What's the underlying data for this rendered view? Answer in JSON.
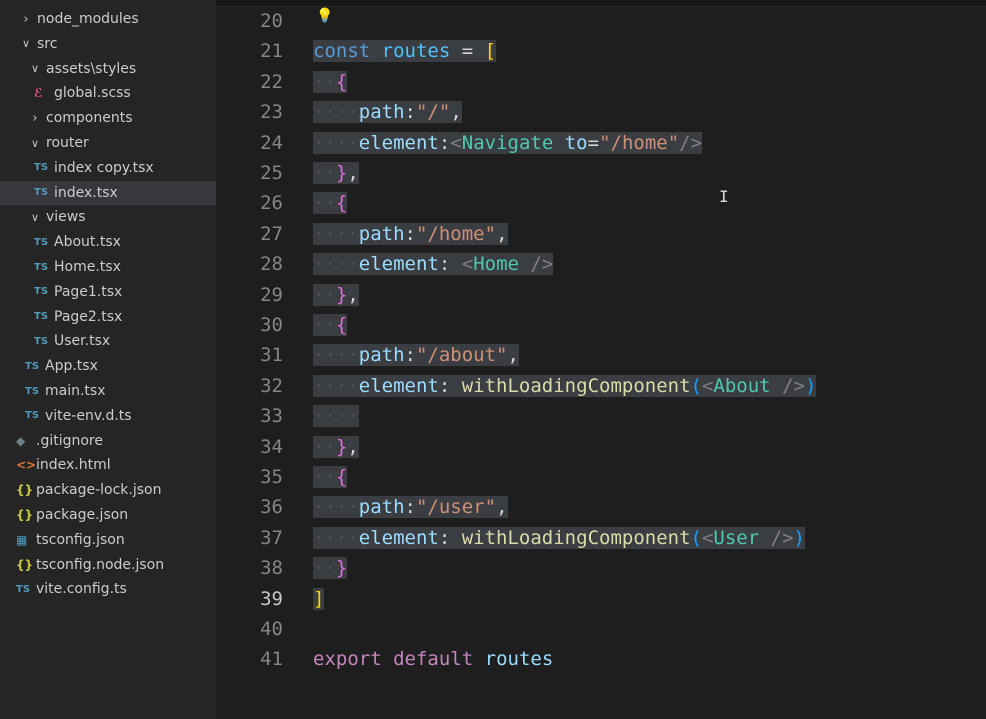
{
  "explorer": {
    "items": [
      {
        "label": "node_modules",
        "kind": "folder",
        "state": "collapsed",
        "depth": 0
      },
      {
        "label": "src",
        "kind": "folder",
        "state": "expanded",
        "depth": 0
      },
      {
        "label": "assets\\styles",
        "kind": "folder",
        "state": "expanded",
        "depth": 1
      },
      {
        "label": "global.scss",
        "kind": "scss",
        "icon": "scss-file-icon",
        "depth": 2
      },
      {
        "label": "components",
        "kind": "folder",
        "state": "collapsed",
        "depth": 1
      },
      {
        "label": "router",
        "kind": "folder",
        "state": "expanded",
        "depth": 1
      },
      {
        "label": "index copy.tsx",
        "kind": "ts",
        "icon": "ts-file-icon",
        "depth": 2
      },
      {
        "label": "index.tsx",
        "kind": "ts",
        "icon": "ts-file-icon",
        "depth": 2,
        "selected": true
      },
      {
        "label": "views",
        "kind": "folder",
        "state": "expanded",
        "depth": 1
      },
      {
        "label": "About.tsx",
        "kind": "ts",
        "icon": "ts-file-icon",
        "depth": 2
      },
      {
        "label": "Home.tsx",
        "kind": "ts",
        "icon": "ts-file-icon",
        "depth": 2
      },
      {
        "label": "Page1.tsx",
        "kind": "ts",
        "icon": "ts-file-icon",
        "depth": 2
      },
      {
        "label": "Page2.tsx",
        "kind": "ts",
        "icon": "ts-file-icon",
        "depth": 2
      },
      {
        "label": "User.tsx",
        "kind": "ts",
        "icon": "ts-file-icon",
        "depth": 2
      },
      {
        "label": "App.tsx",
        "kind": "ts",
        "icon": "ts-file-icon",
        "depth": 1
      },
      {
        "label": "main.tsx",
        "kind": "ts",
        "icon": "ts-file-icon",
        "depth": 1
      },
      {
        "label": "vite-env.d.ts",
        "kind": "ts",
        "icon": "ts-file-icon",
        "depth": 1
      },
      {
        "label": ".gitignore",
        "kind": "git",
        "icon": "git-file-icon",
        "depth": 0
      },
      {
        "label": "index.html",
        "kind": "html",
        "icon": "html-file-icon",
        "depth": 0
      },
      {
        "label": "package-lock.json",
        "kind": "json",
        "icon": "json-file-icon",
        "depth": 0
      },
      {
        "label": "package.json",
        "kind": "json",
        "icon": "json-file-icon",
        "depth": 0
      },
      {
        "label": "tsconfig.json",
        "kind": "cfg",
        "icon": "tsconfig-file-icon",
        "depth": 0
      },
      {
        "label": "tsconfig.node.json",
        "kind": "json",
        "icon": "json-file-icon",
        "depth": 0
      },
      {
        "label": "vite.config.ts",
        "kind": "ts",
        "icon": "ts-file-icon",
        "depth": 0
      }
    ],
    "icon_glyphs": {
      "ts": "TS",
      "scss": "ℰ",
      "json": "{}",
      "html": "<>",
      "git": "◆",
      "cfg": "▦"
    }
  },
  "editor": {
    "active_line": 39,
    "lightbulb_icon": "lightbulb-icon",
    "lines": [
      {
        "num": 20,
        "tokens": []
      },
      {
        "num": 21,
        "tokens": [
          [
            "kw",
            "const"
          ],
          [
            "plain",
            " "
          ],
          [
            "var2",
            "routes"
          ],
          [
            "plain",
            " = "
          ],
          [
            "br1",
            "["
          ]
        ]
      },
      {
        "num": 22,
        "indent": 1,
        "tokens": [
          [
            "br2",
            "{"
          ]
        ]
      },
      {
        "num": 23,
        "indent": 2,
        "tokens": [
          [
            "var",
            "path"
          ],
          [
            "plain",
            ":"
          ],
          [
            "str",
            "\"/\""
          ],
          [
            "plain",
            ","
          ]
        ]
      },
      {
        "num": 24,
        "indent": 2,
        "tokens": [
          [
            "var",
            "element"
          ],
          [
            "plain",
            ":"
          ],
          [
            "punct",
            "<"
          ],
          [
            "tag",
            "Navigate"
          ],
          [
            "plain",
            " "
          ],
          [
            "var",
            "to"
          ],
          [
            "plain",
            "="
          ],
          [
            "str",
            "\"/home\""
          ],
          [
            "punct",
            "/>"
          ]
        ]
      },
      {
        "num": 25,
        "indent": 1,
        "tokens": [
          [
            "br2",
            "}"
          ],
          [
            "plain",
            ","
          ]
        ]
      },
      {
        "num": 26,
        "indent": 1,
        "tokens": [
          [
            "br2",
            "{"
          ]
        ]
      },
      {
        "num": 27,
        "indent": 2,
        "tokens": [
          [
            "var",
            "path"
          ],
          [
            "plain",
            ":"
          ],
          [
            "str",
            "\"/home\""
          ],
          [
            "plain",
            ","
          ]
        ]
      },
      {
        "num": 28,
        "indent": 2,
        "tokens": [
          [
            "var",
            "element"
          ],
          [
            "plain",
            ": "
          ],
          [
            "punct",
            "<"
          ],
          [
            "tag",
            "Home"
          ],
          [
            "plain",
            " "
          ],
          [
            "punct",
            "/>"
          ]
        ]
      },
      {
        "num": 29,
        "indent": 1,
        "tokens": [
          [
            "br2",
            "}"
          ],
          [
            "plain",
            ","
          ]
        ]
      },
      {
        "num": 30,
        "indent": 1,
        "tokens": [
          [
            "br2",
            "{"
          ]
        ]
      },
      {
        "num": 31,
        "indent": 2,
        "tokens": [
          [
            "var",
            "path"
          ],
          [
            "plain",
            ":"
          ],
          [
            "str",
            "\"/about\""
          ],
          [
            "plain",
            ","
          ]
        ]
      },
      {
        "num": 32,
        "indent": 2,
        "tokens": [
          [
            "var",
            "element"
          ],
          [
            "plain",
            ": "
          ],
          [
            "fn",
            "withLoadingComponent"
          ],
          [
            "br3",
            "("
          ],
          [
            "punct",
            "<"
          ],
          [
            "tag",
            "About"
          ],
          [
            "plain",
            " "
          ],
          [
            "punct",
            "/>"
          ],
          [
            "br3",
            ")"
          ]
        ]
      },
      {
        "num": 33,
        "indent": 2,
        "tokens": []
      },
      {
        "num": 34,
        "indent": 1,
        "tokens": [
          [
            "br2",
            "}"
          ],
          [
            "plain",
            ","
          ]
        ]
      },
      {
        "num": 35,
        "indent": 1,
        "tokens": [
          [
            "br2",
            "{"
          ]
        ]
      },
      {
        "num": 36,
        "indent": 2,
        "tokens": [
          [
            "var",
            "path"
          ],
          [
            "plain",
            ":"
          ],
          [
            "str",
            "\"/user\""
          ],
          [
            "plain",
            ","
          ]
        ]
      },
      {
        "num": 37,
        "indent": 2,
        "tokens": [
          [
            "var",
            "element"
          ],
          [
            "plain",
            ": "
          ],
          [
            "fn",
            "withLoadingComponent"
          ],
          [
            "br3",
            "("
          ],
          [
            "punct",
            "<"
          ],
          [
            "tag",
            "User"
          ],
          [
            "plain",
            " "
          ],
          [
            "punct",
            "/>"
          ],
          [
            "br3",
            ")"
          ]
        ]
      },
      {
        "num": 38,
        "indent": 1,
        "tokens": [
          [
            "br2",
            "}"
          ]
        ]
      },
      {
        "num": 39,
        "tokens": [
          [
            "br1",
            "]"
          ]
        ]
      },
      {
        "num": 40,
        "tokens": []
      },
      {
        "num": 41,
        "tokens": [
          [
            "kw2",
            "export"
          ],
          [
            "plain",
            " "
          ],
          [
            "kw2",
            "default"
          ],
          [
            "plain",
            " "
          ],
          [
            "var",
            "routes"
          ]
        ]
      }
    ]
  }
}
